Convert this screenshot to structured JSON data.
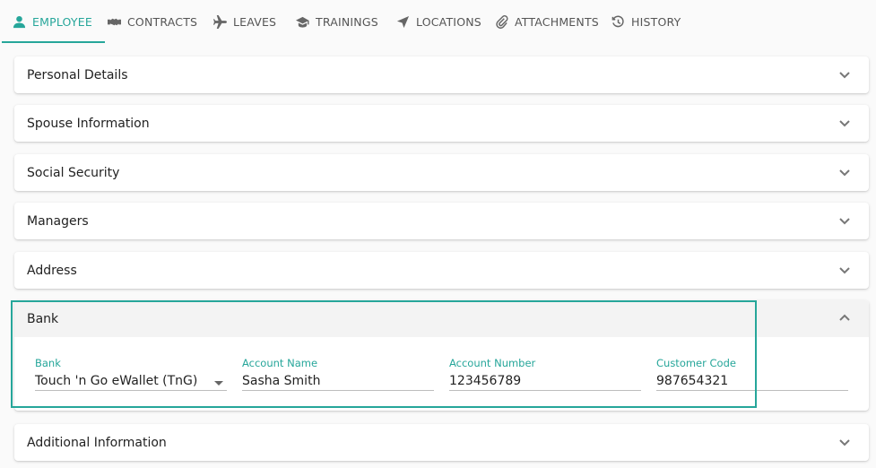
{
  "tabs": [
    {
      "label": "EMPLOYEE",
      "icon": "person-icon",
      "active": true
    },
    {
      "label": "CONTRACTS",
      "icon": "handshake-icon",
      "active": false
    },
    {
      "label": "LEAVES",
      "icon": "airplane-icon",
      "active": false
    },
    {
      "label": "TRAININGS",
      "icon": "graduation-cap-icon",
      "active": false
    },
    {
      "label": "LOCATIONS",
      "icon": "location-arrow-icon",
      "active": false
    },
    {
      "label": "ATTACHMENTS",
      "icon": "paperclip-icon",
      "active": false
    },
    {
      "label": "HISTORY",
      "icon": "history-icon",
      "active": false
    }
  ],
  "sections": {
    "personal": "Personal Details",
    "spouse": "Spouse Information",
    "social": "Social Security",
    "managers": "Managers",
    "address": "Address",
    "bank": "Bank",
    "additional": "Additional Information"
  },
  "bank": {
    "fields": [
      {
        "label": "Bank",
        "value": "Touch 'n Go eWallet (TnG)",
        "type": "select"
      },
      {
        "label": "Account Name",
        "value": "Sasha Smith",
        "type": "text"
      },
      {
        "label": "Account Number",
        "value": "123456789",
        "type": "text"
      },
      {
        "label": "Customer Code",
        "value": "987654321",
        "type": "text"
      }
    ]
  },
  "colors": {
    "accent": "#26a69a",
    "highlight": "#26a69a"
  }
}
